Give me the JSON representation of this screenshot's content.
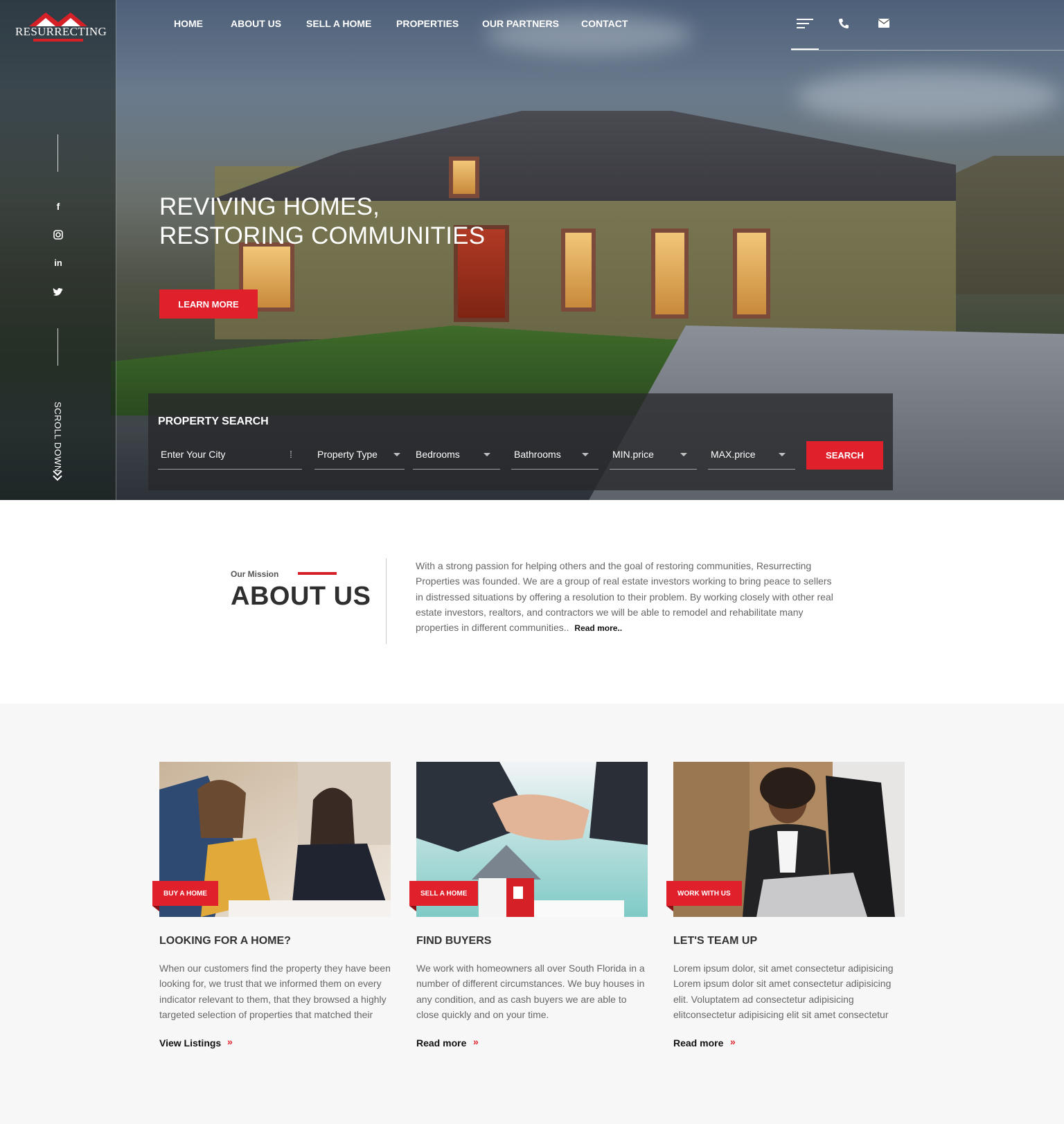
{
  "brand": {
    "logo_text": "RESURRECTING",
    "accent": "#e0202a"
  },
  "nav": {
    "items": [
      "HOME",
      "ABOUT US",
      "SELL A HOME",
      "PROPERTIES",
      "OUR PARTNERS",
      "CONTACT"
    ]
  },
  "header_icons": [
    "menu-icon",
    "phone-icon",
    "envelope-icon"
  ],
  "social": [
    "facebook-icon",
    "instagram-icon",
    "linkedin-icon",
    "twitter-icon"
  ],
  "scroll_label": "SCROLL DOWN",
  "hero": {
    "title_line1": "REVIVING HOMES,",
    "title_line2": "RESTORING COMMUNITIES",
    "cta": "LEARN MORE"
  },
  "search": {
    "title": "PROPERTY SEARCH",
    "city_placeholder": "Enter Your City",
    "property_type": "Property Type",
    "bedrooms": "Bedrooms",
    "bathrooms": "Bathrooms",
    "min_price": "MIN.price",
    "max_price": "MAX.price",
    "button": "SEARCH"
  },
  "about": {
    "eyebrow": "Our Mission",
    "title": "ABOUT US",
    "text": "With a strong passion for helping others and the goal of restoring communities, Resurrecting Properties was founded. We are a group of real estate investors working to bring peace to sellers in distressed situations by offering a resolution to their problem. By working closely with other real estate investors, realtors, and contractors we will be able to remodel and rehabilitate many properties in different communities..",
    "read_more": "Read more.."
  },
  "cards": [
    {
      "tag": "BUY A HOME",
      "title": "LOOKING FOR A HOME?",
      "text": "When our customers find the property they have been looking for, we trust that we informed them on every indicator relevant to them, that they browsed a highly targeted selection of properties that matched their",
      "link": "View Listings"
    },
    {
      "tag": "SELL A HOME",
      "title": "FIND BUYERS",
      "text": "We work with homeowners all over South Florida in a number of different circumstances. We buy houses in any condition, and as cash buyers we are able to close quickly and on your time.",
      "link": "Read more"
    },
    {
      "tag": "WORK WITH US",
      "title": "LET'S TEAM UP",
      "text": "Lorem ipsum dolor, sit amet consectetur adipisicing Lorem ipsum dolor sit amet consectetur adipisicing elit. Voluptatem ad consectetur adipisicing elitconsectetur adipisicing elit sit amet consectetur",
      "link": "Read more"
    }
  ]
}
